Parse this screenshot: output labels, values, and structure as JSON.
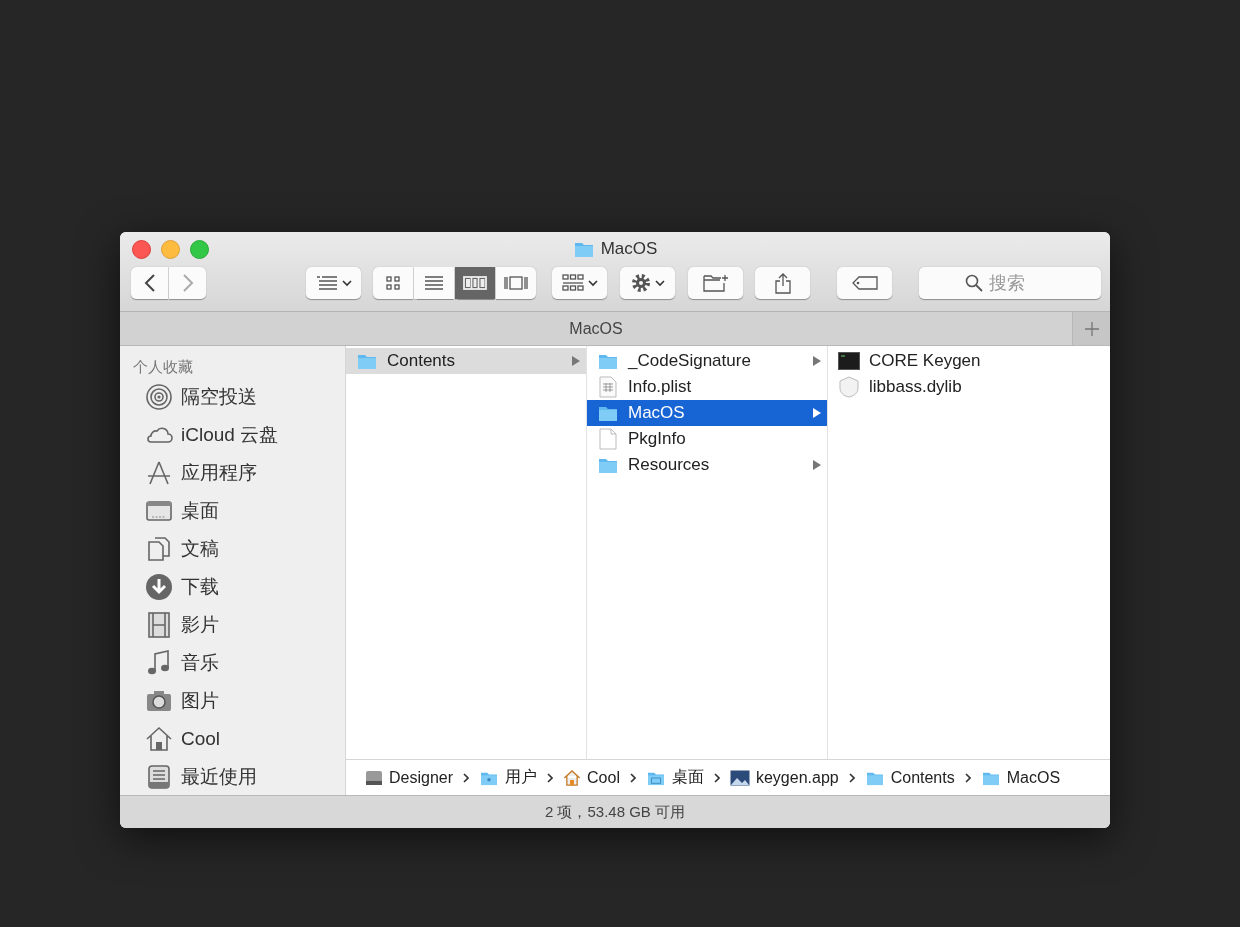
{
  "window": {
    "title": "MacOS"
  },
  "toolbar": {
    "back": {
      "disabled": false
    },
    "forward": {
      "disabled": true
    },
    "view_modes": [
      {
        "kind": "icons",
        "selected": false
      },
      {
        "kind": "list",
        "selected": false
      },
      {
        "kind": "columns",
        "selected": true
      },
      {
        "kind": "gallery",
        "selected": false
      }
    ],
    "search": {
      "placeholder": "搜索"
    }
  },
  "tab_bar": {
    "title": "MacOS"
  },
  "sidebar": {
    "heading": "个人收藏",
    "items": [
      {
        "label": "隔空投送",
        "kind": "airdrop"
      },
      {
        "label": "iCloud 云盘",
        "kind": "cloud"
      },
      {
        "label": "应用程序",
        "kind": "apps"
      },
      {
        "label": "桌面",
        "kind": "desktop"
      },
      {
        "label": "文稿",
        "kind": "documents"
      },
      {
        "label": "下载",
        "kind": "downloads"
      },
      {
        "label": "影片",
        "kind": "movies"
      },
      {
        "label": "音乐",
        "kind": "music"
      },
      {
        "label": "图片",
        "kind": "pictures"
      },
      {
        "label": "Cool",
        "kind": "home"
      },
      {
        "label": "最近使用",
        "kind": "recents"
      }
    ]
  },
  "columns": [
    {
      "focused": false,
      "items": [
        {
          "name": "Contents",
          "kind": "folder",
          "has_children": true,
          "selected": true
        }
      ]
    },
    {
      "focused": true,
      "items": [
        {
          "name": "_CodeSignature",
          "kind": "folder",
          "has_children": true,
          "selected": false
        },
        {
          "name": "Info.plist",
          "kind": "plist",
          "has_children": false,
          "selected": false
        },
        {
          "name": "MacOS",
          "kind": "folder",
          "has_children": true,
          "selected": true
        },
        {
          "name": "PkgInfo",
          "kind": "file",
          "has_children": false,
          "selected": false
        },
        {
          "name": "Resources",
          "kind": "folder",
          "has_children": true,
          "selected": false
        }
      ]
    },
    {
      "items": [
        {
          "name": "CORE Keygen",
          "kind": "executable",
          "has_children": false,
          "selected": false
        },
        {
          "name": "libbass.dylib",
          "kind": "library",
          "has_children": false,
          "selected": false
        }
      ]
    }
  ],
  "path_bar": [
    {
      "label": "Designer",
      "kind": "disk"
    },
    {
      "label": "用户",
      "kind": "users"
    },
    {
      "label": "Cool",
      "kind": "home"
    },
    {
      "label": "桌面",
      "kind": "desktop"
    },
    {
      "label": "keygen.app",
      "kind": "app"
    },
    {
      "label": "Contents",
      "kind": "folder"
    },
    {
      "label": "MacOS",
      "kind": "folder"
    }
  ],
  "status_bar": "2 项，53.48 GB 可用"
}
